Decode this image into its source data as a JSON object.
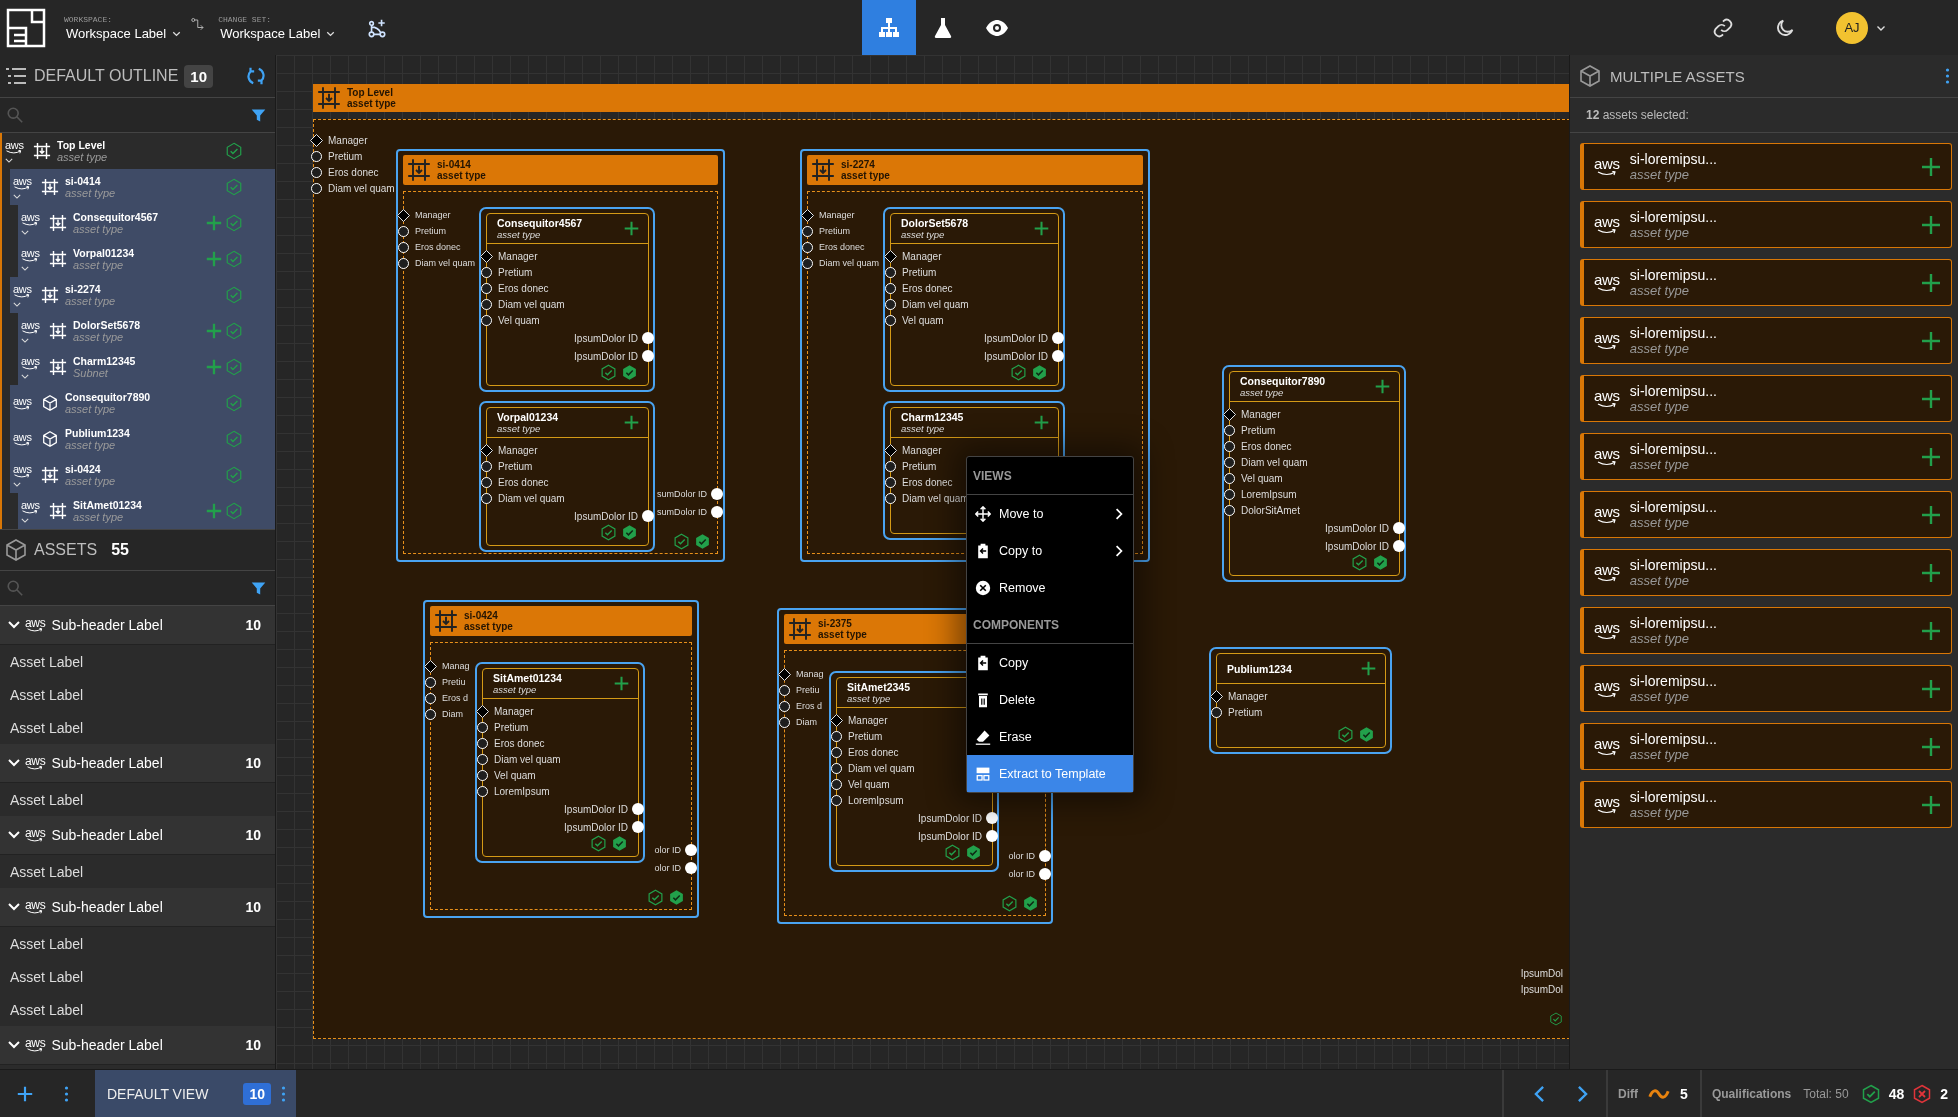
{
  "topbar": {
    "workspace_label": "WORKSPACE:",
    "workspace": "Workspace Label",
    "changeset_label": "CHANGE SET:",
    "changeset": "Workspace Label",
    "modes": [
      {
        "kind": "diagram",
        "selected": true
      },
      {
        "kind": "flask",
        "selected": false
      },
      {
        "kind": "eye",
        "selected": false
      }
    ],
    "avatar": "AJ"
  },
  "outline": {
    "title": "DEFAULT OUTLINE",
    "count": "10",
    "tree": [
      {
        "provider": "aws",
        "name": "Top Level",
        "type": "asset type",
        "kind": "frame",
        "selected": false,
        "expanded": true,
        "added": false,
        "children": [
          {
            "provider": "aws",
            "name": "si-0414",
            "type": "asset type",
            "kind": "frame",
            "selected": true,
            "expanded": true,
            "added": false,
            "children": [
              {
                "provider": "aws",
                "name": "Consequitor4567",
                "type": "asset type",
                "kind": "frame",
                "selected": true,
                "expanded": true,
                "added": true
              },
              {
                "provider": "aws",
                "name": "Vorpal01234",
                "type": "asset type",
                "kind": "frame",
                "selected": true,
                "expanded": true,
                "added": true
              }
            ]
          },
          {
            "provider": "aws",
            "name": "si-2274",
            "type": "asset type",
            "kind": "frame",
            "selected": true,
            "expanded": true,
            "added": false,
            "children": [
              {
                "provider": "aws",
                "name": "DolorSet5678",
                "type": "asset type",
                "kind": "frame",
                "selected": true,
                "expanded": true,
                "added": true
              },
              {
                "provider": "aws",
                "name": "Charm12345",
                "type": "Subnet",
                "kind": "frame",
                "selected": true,
                "expanded": true,
                "added": true
              }
            ]
          },
          {
            "provider": "aws",
            "name": "Consequitor7890",
            "type": "asset type",
            "kind": "component",
            "selected": true,
            "added": false
          },
          {
            "provider": "aws",
            "name": "Publium1234",
            "type": "asset type",
            "kind": "component",
            "selected": true,
            "added": false
          },
          {
            "provider": "aws",
            "name": "si-0424",
            "type": "asset type",
            "kind": "frame",
            "selected": true,
            "expanded": true,
            "added": false,
            "children": [
              {
                "provider": "aws",
                "name": "SitAmet01234",
                "type": "asset type",
                "kind": "frame",
                "selected": true,
                "expanded": true,
                "added": true
              }
            ]
          }
        ]
      }
    ]
  },
  "assets": {
    "title": "ASSETS",
    "count": "55",
    "groups": [
      {
        "provider": "aws",
        "label": "Sub-header Label",
        "count": "10",
        "expanded": true,
        "items": [
          "Asset Label",
          "Asset Label",
          "Asset Label"
        ]
      },
      {
        "provider": "aws",
        "label": "Sub-header Label",
        "count": "10",
        "expanded": true,
        "items": [
          "Asset Label"
        ]
      },
      {
        "provider": "aws",
        "label": "Sub-header Label",
        "count": "10",
        "expanded": true,
        "items": [
          "Asset Label"
        ]
      },
      {
        "provider": "aws",
        "label": "Sub-header Label",
        "count": "10",
        "expanded": true,
        "items": [
          "Asset Label",
          "Asset Label",
          "Asset Label"
        ]
      },
      {
        "provider": "aws",
        "label": "Sub-header Label",
        "count": "10",
        "expanded": true
      }
    ]
  },
  "canvas": {
    "root": {
      "title": "Top Level",
      "type": "asset type",
      "sockets": [
        {
          "label": "Manager",
          "kind": "diamond"
        },
        {
          "label": "Pretium",
          "kind": "circle"
        },
        {
          "label": "Eros donec",
          "kind": "circle"
        },
        {
          "label": "Diam vel quam",
          "kind": "circle"
        }
      ],
      "outputs": [
        "IpsumDol",
        "IpsumDol"
      ]
    },
    "nodes": [
      {
        "kind": "frame",
        "title": "si-0414",
        "type": "asset type",
        "sockets": [
          {
            "label": "Manager",
            "kind": "diamond"
          },
          {
            "label": "Pretium",
            "kind": "circle"
          },
          {
            "label": "Eros donec",
            "kind": "circle"
          },
          {
            "label": "Diam vel quam",
            "kind": "circle"
          }
        ],
        "outputs": [
          "sumDolor ID",
          "sumDolor ID"
        ],
        "checks": true,
        "children": [
          {
            "kind": "component",
            "title": "Consequitor4567",
            "type": "asset type",
            "added": true,
            "checks": true,
            "sockets": [
              {
                "label": "Manager",
                "kind": "diamond"
              },
              {
                "label": "Pretium",
                "kind": "circle"
              },
              {
                "label": "Eros donec",
                "kind": "circle"
              },
              {
                "label": "Diam vel quam",
                "kind": "circle"
              },
              {
                "label": "Vel quam",
                "kind": "circle"
              }
            ],
            "outputs": [
              "IpsumDolor ID",
              "IpsumDolor ID"
            ]
          },
          {
            "kind": "component",
            "title": "Vorpal01234",
            "type": "asset type",
            "added": true,
            "checks": true,
            "sockets": [
              {
                "label": "Manager",
                "kind": "diamond"
              },
              {
                "label": "Pretium",
                "kind": "circle"
              },
              {
                "label": "Eros donec",
                "kind": "circle"
              },
              {
                "label": "Diam vel quam",
                "kind": "circle"
              }
            ],
            "outputs": [
              "IpsumDolor ID"
            ]
          }
        ]
      },
      {
        "kind": "frame",
        "title": "si-2274",
        "type": "asset type",
        "sockets": [
          {
            "label": "Manager",
            "kind": "diamond"
          },
          {
            "label": "Pretium",
            "kind": "circle"
          },
          {
            "label": "Eros donec",
            "kind": "circle"
          },
          {
            "label": "Diam vel quam",
            "kind": "circle"
          }
        ],
        "checks": false,
        "children": [
          {
            "kind": "component",
            "title": "DolorSet5678",
            "type": "asset type",
            "added": true,
            "checks": true,
            "sockets": [
              {
                "label": "Manager",
                "kind": "diamond"
              },
              {
                "label": "Pretium",
                "kind": "circle"
              },
              {
                "label": "Eros donec",
                "kind": "circle"
              },
              {
                "label": "Diam vel quam",
                "kind": "circle"
              },
              {
                "label": "Vel quam",
                "kind": "circle"
              }
            ],
            "outputs": [
              "IpsumDolor ID",
              "IpsumDolor ID"
            ]
          },
          {
            "kind": "component",
            "title": "Charm12345",
            "type": "asset type",
            "added": true,
            "checks": false,
            "sockets": [
              {
                "label": "Manager",
                "kind": "diamond"
              },
              {
                "label": "Pretium",
                "kind": "circle"
              },
              {
                "label": "Eros donec",
                "kind": "circle"
              },
              {
                "label": "Diam vel quam",
                "kind": "circle"
              }
            ]
          }
        ]
      },
      {
        "kind": "component",
        "title": "Consequitor7890",
        "type": "asset type",
        "added": true,
        "checks": true,
        "sockets": [
          {
            "label": "Manager",
            "kind": "diamond"
          },
          {
            "label": "Pretium",
            "kind": "circle"
          },
          {
            "label": "Eros donec",
            "kind": "circle"
          },
          {
            "label": "Diam vel quam",
            "kind": "circle"
          },
          {
            "label": "Vel quam",
            "kind": "circle"
          },
          {
            "label": "LoremIpsum",
            "kind": "circle"
          },
          {
            "label": "DolorSitAmet",
            "kind": "circle"
          }
        ],
        "outputs": [
          "IpsumDolor ID",
          "IpsumDolor ID"
        ]
      },
      {
        "kind": "frame",
        "title": "si-0424",
        "type": "asset type",
        "sockets": [
          {
            "label": "Manag",
            "kind": "diamond"
          },
          {
            "label": "Pretiu",
            "kind": "circle"
          },
          {
            "label": "Eros d",
            "kind": "circle"
          },
          {
            "label": "Diam",
            "kind": "circle"
          }
        ],
        "outputs": [
          "olor ID",
          "olor ID"
        ],
        "checks": true,
        "children": [
          {
            "kind": "component",
            "title": "SitAmet01234",
            "type": "asset type",
            "added": true,
            "checks": true,
            "sockets": [
              {
                "label": "Manager",
                "kind": "diamond"
              },
              {
                "label": "Pretium",
                "kind": "circle"
              },
              {
                "label": "Eros donec",
                "kind": "circle"
              },
              {
                "label": "Diam vel quam",
                "kind": "circle"
              },
              {
                "label": "Vel quam",
                "kind": "circle"
              },
              {
                "label": "LoremIpsum",
                "kind": "circle"
              }
            ],
            "outputs": [
              "IpsumDolor ID",
              "IpsumDolor ID"
            ]
          }
        ]
      },
      {
        "kind": "frame",
        "title": "si-2375",
        "type": "asset type",
        "sockets": [
          {
            "label": "Manag",
            "kind": "diamond"
          },
          {
            "label": "Pretiu",
            "kind": "circle"
          },
          {
            "label": "Eros d",
            "kind": "circle"
          },
          {
            "label": "Diam",
            "kind": "circle"
          }
        ],
        "outputs": [
          "olor ID",
          "olor ID"
        ],
        "checks": true,
        "children": [
          {
            "kind": "component",
            "title": "SitAmet2345",
            "type": "asset type",
            "added": false,
            "checks": true,
            "sockets": [
              {
                "label": "Manager",
                "kind": "diamond"
              },
              {
                "label": "Pretium",
                "kind": "circle"
              },
              {
                "label": "Eros donec",
                "kind": "circle"
              },
              {
                "label": "Diam vel quam",
                "kind": "circle"
              },
              {
                "label": "Vel quam",
                "kind": "circle"
              },
              {
                "label": "LoremIpsum",
                "kind": "circle"
              }
            ],
            "outputs": [
              "IpsumDolor ID",
              "IpsumDolor ID"
            ]
          }
        ]
      },
      {
        "kind": "component",
        "title": "Publium1234",
        "added": true,
        "checks": true,
        "sockets": [
          {
            "label": "Manager",
            "kind": "diamond"
          },
          {
            "label": "Pretium",
            "kind": "circle"
          }
        ]
      }
    ]
  },
  "context_menu": {
    "sections": [
      {
        "title": "VIEWS",
        "items": [
          {
            "label": "Move to",
            "submenu": true,
            "selected": false
          },
          {
            "label": "Copy to",
            "submenu": true,
            "selected": false
          },
          {
            "label": "Remove",
            "submenu": false,
            "selected": false
          }
        ]
      },
      {
        "title": "COMPONENTS",
        "items": [
          {
            "label": "Copy",
            "submenu": false,
            "selected": false
          },
          {
            "label": "Delete",
            "submenu": false,
            "selected": false
          },
          {
            "label": "Erase",
            "submenu": false,
            "selected": false
          },
          {
            "label": "Extract to Template",
            "submenu": false,
            "selected": true
          }
        ]
      }
    ]
  },
  "details": {
    "title": "MULTIPLE ASSETS",
    "summary": "**12** assets selected:",
    "assets": [
      {
        "provider": "aws",
        "name": "si-loremipsu...",
        "type": "asset type"
      },
      {
        "provider": "aws",
        "name": "si-loremipsu...",
        "type": "asset type"
      },
      {
        "provider": "aws",
        "name": "si-loremipsu...",
        "type": "asset type"
      },
      {
        "provider": "aws",
        "name": "si-loremipsu...",
        "type": "asset type"
      },
      {
        "provider": "aws",
        "name": "si-loremipsu...",
        "type": "asset type"
      },
      {
        "provider": "aws",
        "name": "si-loremipsu...",
        "type": "asset type"
      },
      {
        "provider": "aws",
        "name": "si-loremipsu...",
        "type": "asset type"
      },
      {
        "provider": "aws",
        "name": "si-loremipsu...",
        "type": "asset type"
      },
      {
        "provider": "aws",
        "name": "si-loremipsu...",
        "type": "asset type"
      },
      {
        "provider": "aws",
        "name": "si-loremipsu...",
        "type": "asset type"
      },
      {
        "provider": "aws",
        "name": "si-loremipsu...",
        "type": "asset type"
      },
      {
        "provider": "aws",
        "name": "si-loremipsu...",
        "type": "asset type"
      }
    ]
  },
  "bottombar": {
    "view": "DEFAULT VIEW",
    "view_count": "10",
    "diff_label": "Diff",
    "diff_count": "5",
    "qual_label": "Qualifications",
    "total": "Total: 50",
    "passed": "48",
    "failed": "2"
  }
}
